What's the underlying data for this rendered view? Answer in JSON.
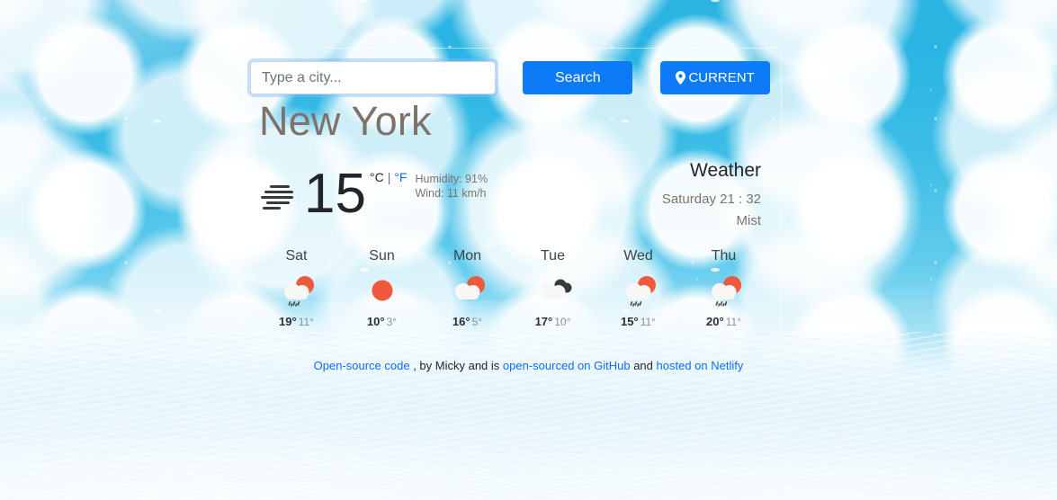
{
  "search": {
    "placeholder": "Type a city...",
    "value": "",
    "search_label": "Search",
    "current_label": "CURRENT",
    "pin_icon": "location-pin-icon"
  },
  "city": "New York",
  "current": {
    "icon": "mist-icon",
    "temperature": "15",
    "unit_c": "°C",
    "unit_separator": "|",
    "unit_f": "°F",
    "humidity": "Humidity: 91%",
    "wind": "Wind: 11 km/h",
    "heading": "Weather",
    "datetime": "Saturday 21 : 32",
    "description": "Mist"
  },
  "forecast": [
    {
      "day": "Sat",
      "icon": "sun-cloud-rain-icon",
      "high": "19°",
      "low": "11°"
    },
    {
      "day": "Sun",
      "icon": "sun-icon",
      "high": "10°",
      "low": "3°"
    },
    {
      "day": "Mon",
      "icon": "sun-cloud-icon",
      "high": "16°",
      "low": "5°"
    },
    {
      "day": "Tue",
      "icon": "clouds-icon",
      "high": "17°",
      "low": "10°"
    },
    {
      "day": "Wed",
      "icon": "sun-cloud-rain-icon",
      "high": "15°",
      "low": "11°"
    },
    {
      "day": "Thu",
      "icon": "sun-cloud-rain-icon",
      "high": "20°",
      "low": "11°"
    }
  ],
  "footer": {
    "link1": "Open-source code",
    "text1": ", by Micky and is",
    "link2": "open-sourced on GitHub",
    "text2": "and",
    "link3": "hosted on Netlify"
  },
  "colors": {
    "accent_blue": "#0d7bf7",
    "link_blue": "#0d6efd",
    "muted_text": "#7d736b",
    "sun_orange": "#ef5a3c",
    "cloud_white": "#f7f7f5",
    "dark_cloud": "#3a3a3a"
  }
}
